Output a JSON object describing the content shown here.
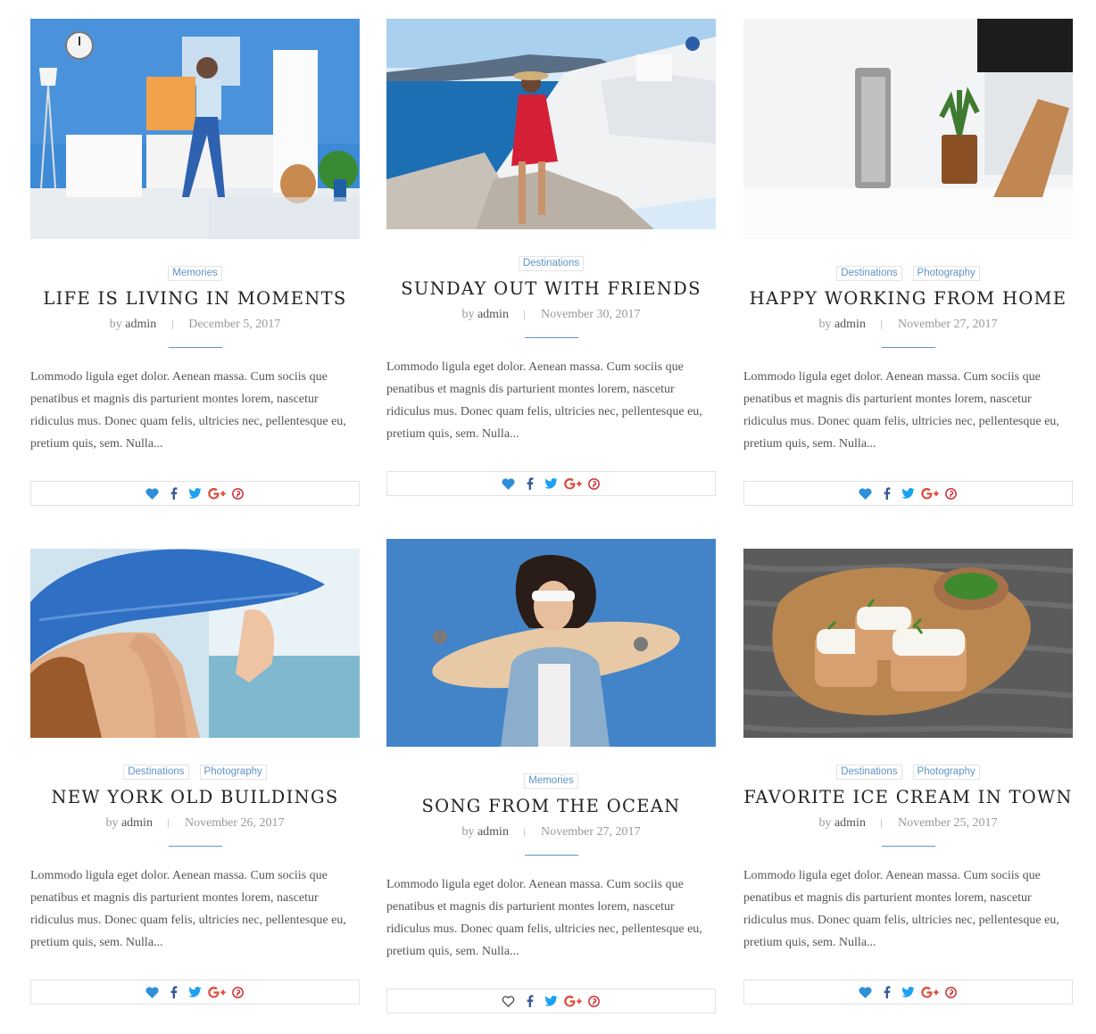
{
  "posts": [
    {
      "categories": [
        "Memories"
      ],
      "title": "LIFE IS LIVING IN MOMENTS",
      "by": "by",
      "author": "admin",
      "date": "December 5, 2017",
      "excerpt": "Lommodo ligula eget dolor. Aenean massa. Cum sociis que penatibus et magnis dis parturient montes lorem, nascetur ridiculus mus. Donec quam felis, ultricies nec, pellentesque eu, pretium quis, sem. Nulla...",
      "liked": true,
      "image": "woman-dancing-room"
    },
    {
      "categories": [
        "Destinations"
      ],
      "title": "SUNDAY OUT WITH FRIENDS",
      "by": "by",
      "author": "admin",
      "date": "November 30, 2017",
      "excerpt": "Lommodo ligula eget dolor. Aenean massa. Cum sociis que penatibus et magnis dis parturient montes lorem, nascetur ridiculus mus. Donec quam felis, ultricies nec, pellentesque eu, pretium quis, sem. Nulla...",
      "liked": true,
      "image": "woman-red-dress-santorini"
    },
    {
      "categories": [
        "Destinations",
        "Photography"
      ],
      "title": "HAPPY WORKING FROM HOME",
      "by": "by",
      "author": "admin",
      "date": "November 27, 2017",
      "excerpt": "Lommodo ligula eget dolor. Aenean massa. Cum sociis que penatibus et magnis dis parturient montes lorem, nascetur ridiculus mus. Donec quam felis, ultricies nec, pellentesque eu, pretium quis, sem. Nulla...",
      "liked": true,
      "image": "desk-speaker-plant"
    },
    {
      "categories": [
        "Destinations",
        "Photography"
      ],
      "title": "NEW YORK OLD BUILDINGS",
      "by": "by",
      "author": "admin",
      "date": "November 26, 2017",
      "excerpt": "Lommodo ligula eget dolor. Aenean massa. Cum sociis que penatibus et magnis dis parturient montes lorem, nascetur ridiculus mus. Donec quam felis, ultricies nec, pellentesque eu, pretium quis, sem. Nulla...",
      "liked": true,
      "image": "woman-blue-hat-beach"
    },
    {
      "categories": [
        "Memories"
      ],
      "title": "SONG FROM THE OCEAN",
      "by": "by",
      "author": "admin",
      "date": "November 27, 2017",
      "excerpt": "Lommodo ligula eget dolor. Aenean massa. Cum sociis que penatibus et magnis dis parturient montes lorem, nascetur ridiculus mus. Donec quam felis, ultricies nec, pellentesque eu, pretium quis, sem. Nulla...",
      "liked": false,
      "image": "woman-skateboard-sunglasses"
    },
    {
      "categories": [
        "Destinations",
        "Photography"
      ],
      "title": "FAVORITE ICE CREAM IN TOWN",
      "by": "by",
      "author": "admin",
      "date": "November 25, 2017",
      "excerpt": "Lommodo ligula eget dolor. Aenean massa. Cum sociis que penatibus et magnis dis parturient montes lorem, nascetur ridiculus mus. Donec quam felis, ultricies nec, pellentesque eu, pretium quis, sem. Nulla...",
      "liked": true,
      "image": "bruschetta-wooden-board"
    }
  ],
  "share_icons": [
    "heart-icon",
    "facebook-icon",
    "twitter-icon",
    "google-plus-icon",
    "pinterest-icon"
  ],
  "colors": {
    "accent": "#5e94c7",
    "heart": "#2f8fd8",
    "facebook": "#3b5998",
    "twitter": "#1da1f2",
    "google_plus": "#dd4b39",
    "pinterest": "#cb2027"
  }
}
